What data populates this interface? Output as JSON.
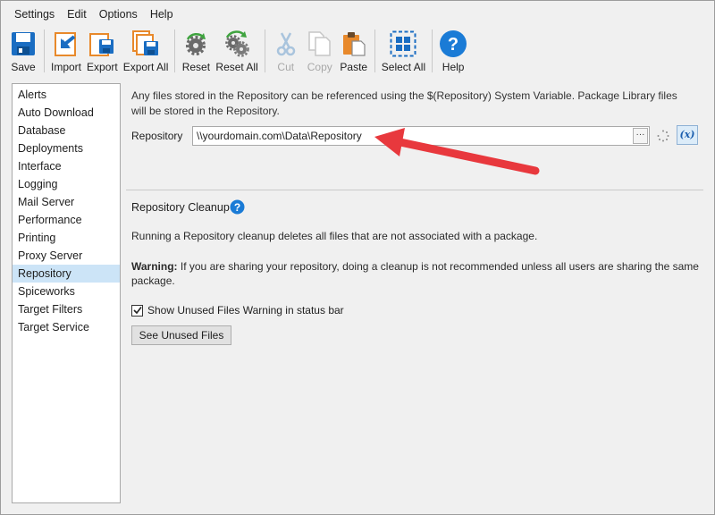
{
  "menubar": {
    "items": [
      "Settings",
      "Edit",
      "Options",
      "Help"
    ]
  },
  "toolbar": {
    "save": "Save",
    "import": "Import",
    "export": "Export",
    "export_all": "Export All",
    "reset": "Reset",
    "reset_all": "Reset All",
    "cut": "Cut",
    "copy": "Copy",
    "paste": "Paste",
    "select_all": "Select All",
    "help": "Help"
  },
  "nav": {
    "items": [
      "Alerts",
      "Auto Download",
      "Database",
      "Deployments",
      "Interface",
      "Logging",
      "Mail Server",
      "Performance",
      "Printing",
      "Proxy Server",
      "Repository",
      "Spiceworks",
      "Target Filters",
      "Target Service"
    ],
    "selected": "Repository"
  },
  "repository": {
    "description": "Any files stored in the Repository can be referenced using the $(Repository) System Variable. Package Library files will be stored in the Repository.",
    "label": "Repository",
    "value": "\\\\yourdomain.com\\Data\\Repository",
    "browse_label": "···",
    "variable_label": "(x)"
  },
  "cleanup": {
    "title": "Repository Cleanup",
    "description": "Running a Repository cleanup deletes all files that are not associated with a package.",
    "warning_label": "Warning:",
    "warning_text": " If you are sharing your repository, doing a cleanup is not recommended unless all users are sharing the same package.",
    "checkbox_label": "Show Unused Files Warning in status bar",
    "checkbox_checked": true,
    "button_label": "See Unused Files"
  },
  "colors": {
    "accent_blue": "#1a7bd6",
    "arrow_red": "#e8383d",
    "selection": "#cce4f7"
  }
}
